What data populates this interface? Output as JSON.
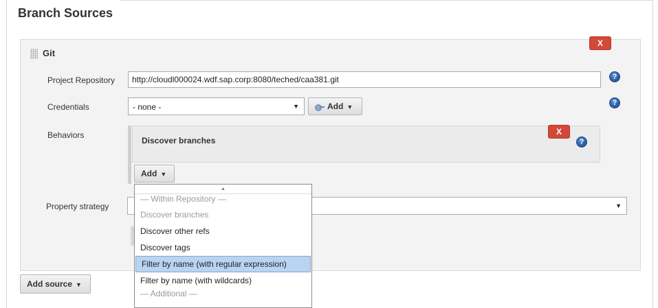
{
  "section": {
    "title": "Branch Sources"
  },
  "git": {
    "label": "Git",
    "close_label": "X",
    "project_repository": {
      "label": "Project Repository",
      "value": "http://cloudl000024.wdf.sap.corp:8080/teched/caa381.git"
    },
    "credentials": {
      "label": "Credentials",
      "selected": "- none -",
      "add_label": "Add"
    },
    "behaviors": {
      "label": "Behaviors",
      "items": [
        {
          "title": "Discover branches",
          "close_label": "X"
        }
      ],
      "add_label": "Add"
    },
    "property_strategy": {
      "label": "Property strategy"
    },
    "help_glyph": "?"
  },
  "behaviors_menu": {
    "items": [
      {
        "label": "— Within Repository —",
        "type": "header"
      },
      {
        "label": "Discover branches",
        "type": "disabled"
      },
      {
        "label": "Discover other refs",
        "type": "normal"
      },
      {
        "label": "Discover tags",
        "type": "normal"
      },
      {
        "label": "Filter by name (with regular expression)",
        "type": "active"
      },
      {
        "label": "Filter by name (with wildcards)",
        "type": "normal"
      },
      {
        "label": "— Additional —",
        "type": "header"
      }
    ]
  },
  "footer": {
    "add_source_label": "Add source"
  },
  "icons": {
    "drag": "drag-handle-icon",
    "help": "help-icon",
    "key": "key-icon",
    "caret": "chevron-down-icon"
  },
  "colors": {
    "close_button": "#d24939",
    "help_icon": "#2a5fa8",
    "menu_active": "#b9d4f1",
    "panel_bg": "#f3f3f3"
  }
}
